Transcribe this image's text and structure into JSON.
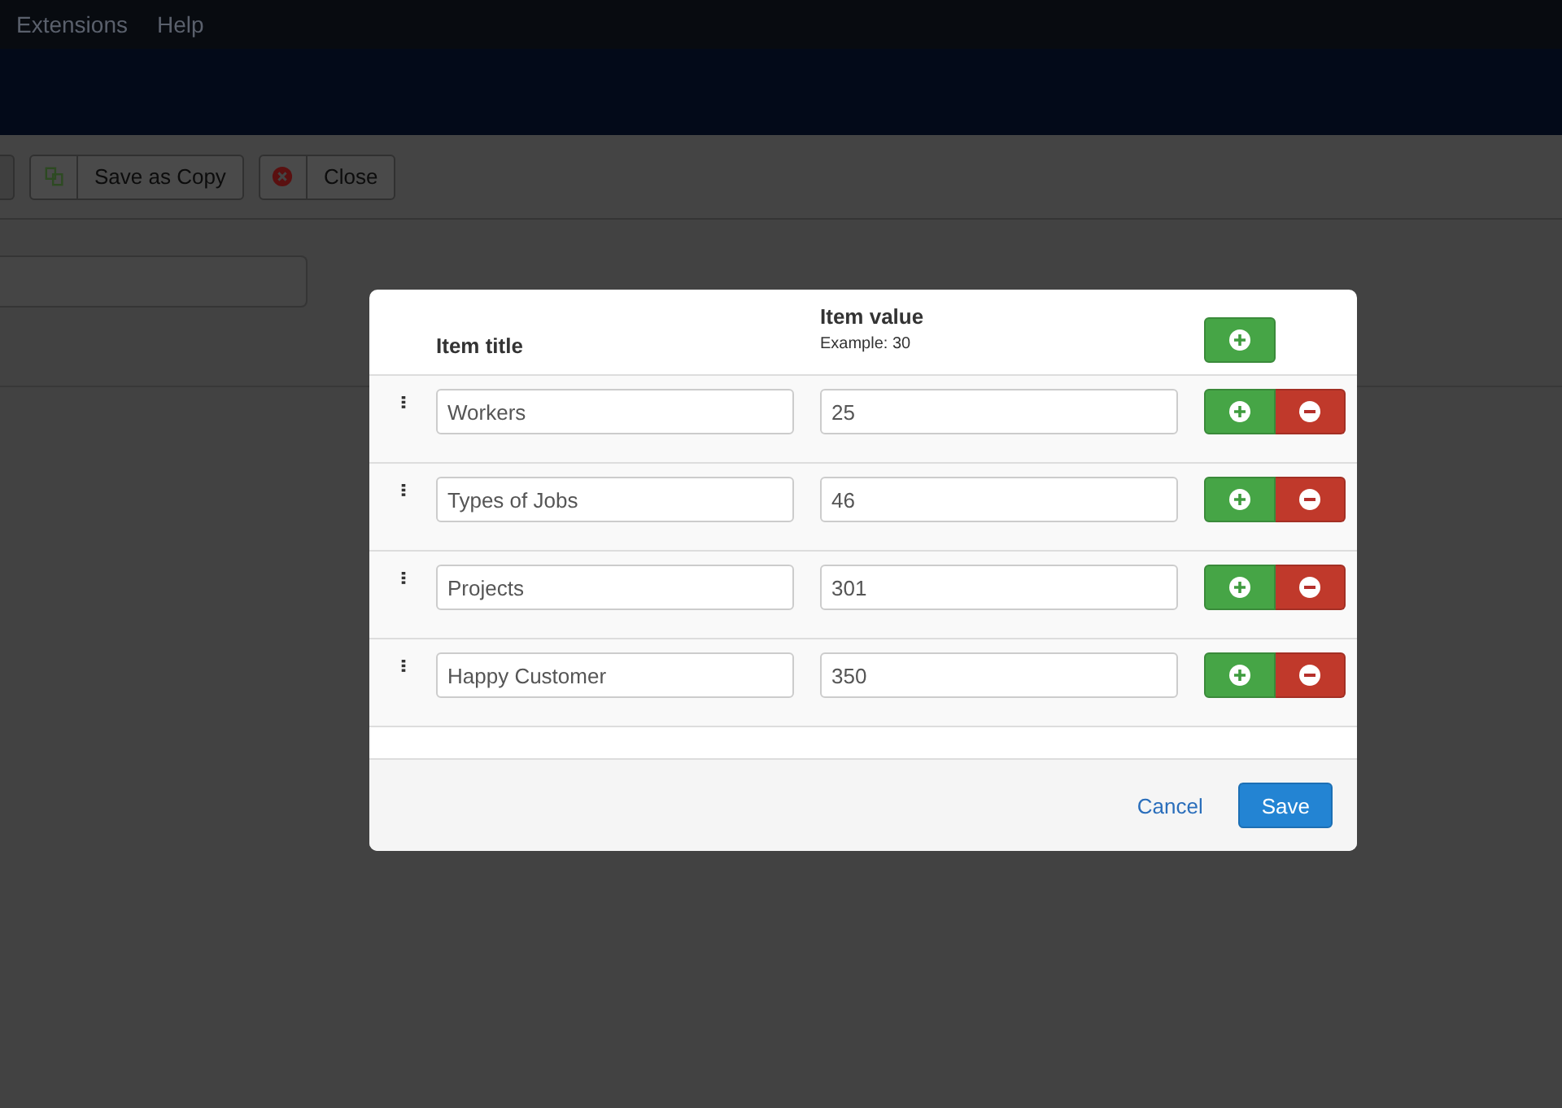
{
  "menu": [
    {
      "label": "Extensions"
    },
    {
      "label": "Help"
    }
  ],
  "toolbar": {
    "buttons": [
      {
        "label": "Save as Copy",
        "kind": "copy"
      },
      {
        "label": "Close",
        "kind": "close"
      }
    ]
  },
  "modal": {
    "columns": [
      {
        "title": "Item title"
      },
      {
        "title": "Item value",
        "hint": "Example: 30"
      }
    ],
    "rows": [
      {
        "title": "Workers",
        "value": "25"
      },
      {
        "title": "Types of Jobs",
        "value": "46"
      },
      {
        "title": "Projects",
        "value": "301"
      },
      {
        "title": "Happy Customer",
        "value": "350"
      }
    ],
    "footer": {
      "cancel": "Cancel",
      "save": "Save"
    }
  }
}
